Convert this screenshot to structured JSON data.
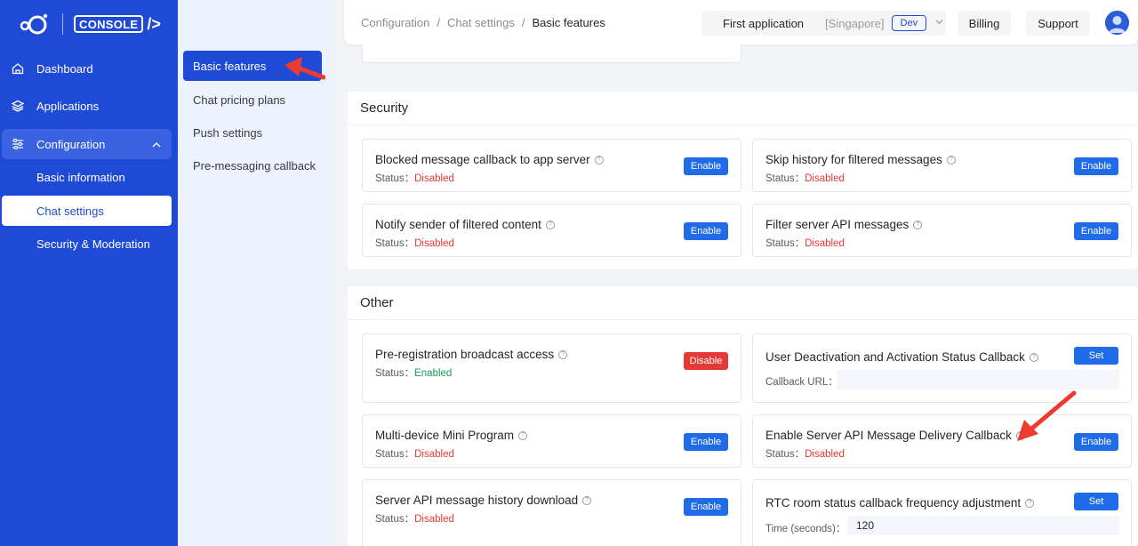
{
  "sidebar": {
    "logo_text": "CONSOLE",
    "items": [
      {
        "label": "Dashboard",
        "icon": "home-icon"
      },
      {
        "label": "Applications",
        "icon": "layers-icon"
      },
      {
        "label": "Configuration",
        "icon": "sliders-icon"
      }
    ],
    "sub_items": [
      {
        "label": "Basic information"
      },
      {
        "label": "Chat settings"
      },
      {
        "label": "Security & Moderation"
      }
    ]
  },
  "secondary_sidebar": {
    "items": [
      {
        "label": "Basic features"
      },
      {
        "label": "Chat pricing plans"
      },
      {
        "label": "Push settings"
      },
      {
        "label": "Pre-messaging callback"
      }
    ]
  },
  "header": {
    "breadcrumb": [
      "Configuration",
      "Chat settings",
      "Basic features"
    ],
    "separator": "/",
    "app_name": "First application",
    "region": "[Singapore]",
    "env": "Dev",
    "billing": "Billing",
    "support": "Support"
  },
  "security": {
    "title": "Security",
    "cards": [
      {
        "title": "Blocked message callback to app server",
        "status_label": "Status：",
        "status": "Disabled",
        "button": "Enable"
      },
      {
        "title": "Skip history for filtered messages",
        "status_label": "Status：",
        "status": "Disabled",
        "button": "Enable"
      },
      {
        "title": "Notify sender of filtered content",
        "status_label": "Status：",
        "status": "Disabled",
        "button": "Enable"
      },
      {
        "title": "Filter server API messages",
        "status_label": "Status：",
        "status": "Disabled",
        "button": "Enable"
      }
    ]
  },
  "other": {
    "title": "Other",
    "cards": [
      {
        "title": "Pre-registration broadcast access",
        "status_label": "Status：",
        "status": "Enabled",
        "button": "Disable"
      },
      {
        "title": "User Deactivation and Activation Status Callback",
        "field_label": "Callback URL：",
        "field_value": "",
        "button": "Set"
      },
      {
        "title": "Multi-device Mini Program",
        "status_label": "Status：",
        "status": "Disabled",
        "button": "Enable"
      },
      {
        "title": "Enable Server API Message Delivery Callback",
        "status_label": "Status：",
        "status": "Disabled",
        "button": "Enable"
      },
      {
        "title": "Server API message history download",
        "status_label": "Status：",
        "status": "Disabled",
        "button": "Enable"
      },
      {
        "title": "RTC room status callback frequency adjustment",
        "field_label": "Time (seconds)：",
        "field_value": "120",
        "button": "Set"
      }
    ]
  },
  "colors": {
    "brand": "#1f4ad6",
    "disabled": "#e53935",
    "enabled": "#18a058",
    "annotation": "#ee3b2f"
  }
}
